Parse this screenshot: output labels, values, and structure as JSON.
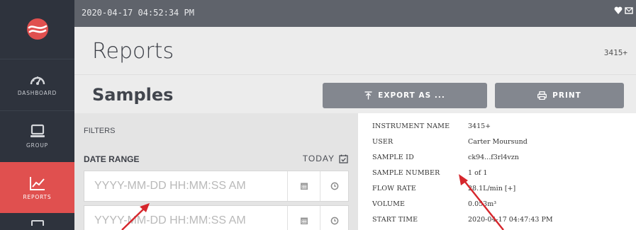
{
  "topbar": {
    "timestamp": "2020-04-17 04:52:34 PM",
    "icons": [
      "heart-shield-icon",
      "envelope-icon"
    ]
  },
  "sidebar": {
    "logo": "brand-logo",
    "items": [
      {
        "label": "DASHBOARD",
        "icon": "speedometer-icon",
        "active": false
      },
      {
        "label": "GROUP",
        "icon": "monitor-icon",
        "active": false
      },
      {
        "label": "REPORTS",
        "icon": "line-chart-icon",
        "active": true
      }
    ]
  },
  "header": {
    "title": "Reports",
    "instrument": "3415+"
  },
  "subheader": {
    "title": "Samples",
    "export_label": "EXPORT AS ...",
    "print_label": "PRINT"
  },
  "filters": {
    "label": "FILTERS",
    "date_range_label": "DATE RANGE",
    "today_label": "TODAY",
    "start_placeholder": "YYYY-MM-DD HH:MM:SS AM",
    "end_placeholder": "YYYY-MM-DD HH:MM:SS AM"
  },
  "details": [
    {
      "key": "INSTRUMENT NAME",
      "value": "3415+"
    },
    {
      "key": "USER",
      "value": "Carter Moursund"
    },
    {
      "key": "SAMPLE ID",
      "value": "ck94...f3rl4vzn"
    },
    {
      "key": "SAMPLE NUMBER",
      "value": "1 of 1"
    },
    {
      "key": "FLOW RATE",
      "value": "28.1L/min [+]"
    },
    {
      "key": "VOLUME",
      "value": "0.053m³"
    },
    {
      "key": "START TIME",
      "value": "2020-04-17 04:47:43 PM"
    }
  ],
  "colors": {
    "sidebar": "#2e333d",
    "active_nav": "#e0504f",
    "annotation_arrow": "#d6262c",
    "button": "#83878f"
  }
}
